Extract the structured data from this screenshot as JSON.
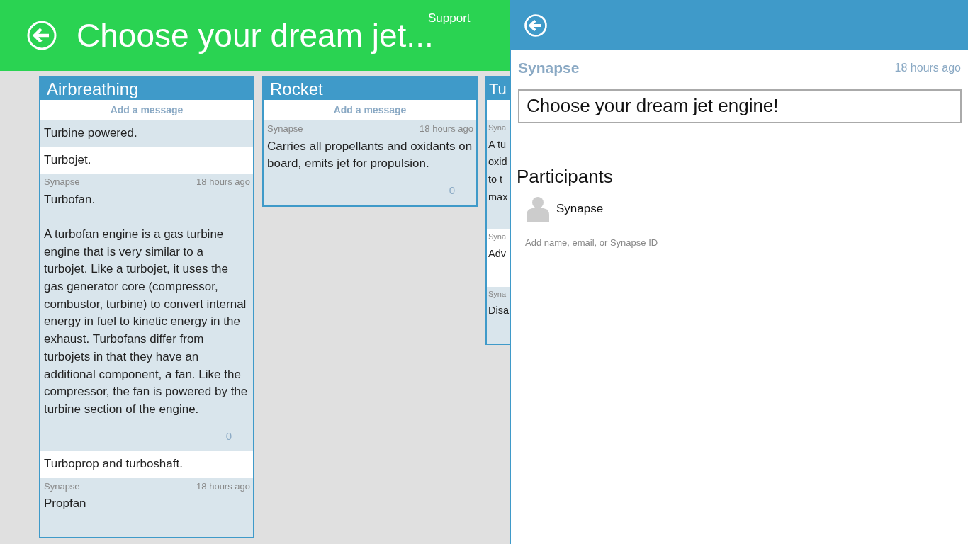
{
  "header": {
    "title": "Choose your dream jet...",
    "support": "Support"
  },
  "columns": [
    {
      "title": "Airbreathing",
      "add_message": "Add a message",
      "items": [
        {
          "kind": "note",
          "text": "Turbine powered."
        },
        {
          "kind": "note",
          "text": "Turbojet."
        },
        {
          "kind": "message",
          "author": "Synapse",
          "time": "18 hours ago",
          "text": "Turbofan.\n\nA turbofan engine is a gas turbine engine that is very similar to a turbojet. Like a turbojet, it uses the gas generator core (compressor, combustor, turbine) to convert internal energy in fuel to kinetic energy in the exhaust. Turbofans differ from turbojets in that they have an additional component, a fan. Like the compressor, the fan is powered by the turbine section of the engine.",
          "count": "0"
        },
        {
          "kind": "note",
          "text": "Turboprop and turboshaft."
        },
        {
          "kind": "message",
          "author": "Synapse",
          "time": "18 hours ago",
          "text": "Propfan"
        }
      ]
    },
    {
      "title": "Rocket",
      "add_message": "Add a message",
      "items": [
        {
          "kind": "message",
          "author": "Synapse",
          "time": "18 hours ago",
          "text": "Carries all propellants and oxidants on board, emits jet for propulsion.",
          "count": "0"
        }
      ]
    },
    {
      "title": "Tu",
      "items": [
        {
          "kind": "message",
          "author": "Syna",
          "text": "A tu\noxid\nto t\nmax"
        },
        {
          "kind": "message",
          "author": "Syna",
          "text": "Adv"
        },
        {
          "kind": "message",
          "author": "Syna",
          "text": "Disa"
        }
      ]
    }
  ],
  "panel": {
    "author": "Synapse",
    "time": "18 hours ago",
    "title_value": "Choose your dream jet engine!",
    "participants_heading": "Participants",
    "participants": [
      {
        "name": "Synapse"
      }
    ],
    "add_placeholder": "Add name, email, or Synapse ID"
  }
}
